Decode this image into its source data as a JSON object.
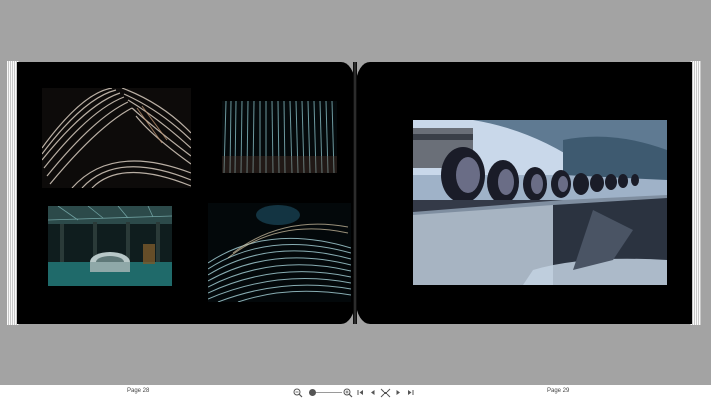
{
  "book": {
    "left_page": {
      "label": "Page 28",
      "photos": [
        {
          "name": "wire-coils-closeup"
        },
        {
          "name": "cyan-wire-strands"
        },
        {
          "name": "factory-hall-with-coil"
        },
        {
          "name": "wire-bundle-dark"
        }
      ]
    },
    "right_page": {
      "label": "Page 29",
      "photos": [
        {
          "name": "industrial-pipes-river"
        }
      ]
    }
  },
  "toolbar": {
    "zoom_out_icon": "magnifier-minus-icon",
    "zoom_in_icon": "magnifier-plus-icon",
    "zoom_level": 0.1,
    "first_icon": "first-page-icon",
    "prev_icon": "previous-page-icon",
    "spread_icon": "page-spread-icon",
    "next_icon": "next-page-icon",
    "last_icon": "last-page-icon"
  },
  "colors": {
    "background": "#a3a3a3",
    "page": "#000000",
    "statusbar": "#ffffff"
  }
}
